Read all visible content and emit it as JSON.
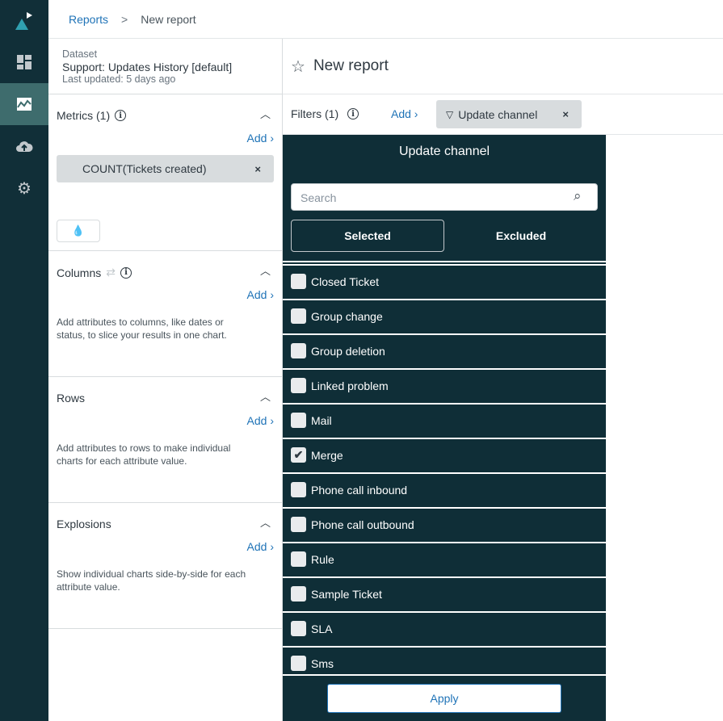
{
  "breadcrumb": {
    "parent": "Reports",
    "separator": ">",
    "current": "New report"
  },
  "dataset": {
    "label": "Dataset",
    "name": "Support: Updates History [default]",
    "updated": "Last updated: 5 days ago"
  },
  "metrics": {
    "title": "Metrics (1)",
    "add": "Add ›",
    "pill": "COUNT(Tickets created)",
    "remove": "×"
  },
  "columns": {
    "title": "Columns",
    "add": "Add ›",
    "help": "Add attributes to columns, like dates or status, to slice your results in one chart."
  },
  "rows": {
    "title": "Rows",
    "add": "Add ›",
    "help": "Add attributes to rows to make individual charts for each attribute value."
  },
  "explosions": {
    "title": "Explosions",
    "add": "Add ›",
    "help": "Show individual charts side-by-side for each attribute value."
  },
  "report": {
    "title": "New report"
  },
  "filters": {
    "title": "Filters (1)",
    "add": "Add ›",
    "chip": "Update channel",
    "remove": "×"
  },
  "popup": {
    "title": "Update channel",
    "search_placeholder": "Search",
    "tab_selected": "Selected",
    "tab_excluded": "Excluded",
    "apply": "Apply",
    "items": [
      {
        "label": "Closed Ticket",
        "checked": false
      },
      {
        "label": "Group change",
        "checked": false
      },
      {
        "label": "Group deletion",
        "checked": false
      },
      {
        "label": "Linked problem",
        "checked": false
      },
      {
        "label": "Mail",
        "checked": false
      },
      {
        "label": "Merge",
        "checked": true
      },
      {
        "label": "Phone call inbound",
        "checked": false
      },
      {
        "label": "Phone call outbound",
        "checked": false
      },
      {
        "label": "Rule",
        "checked": false
      },
      {
        "label": "Sample Ticket",
        "checked": false
      },
      {
        "label": "SLA",
        "checked": false
      },
      {
        "label": "Sms",
        "checked": false
      },
      {
        "label": "",
        "checked": false
      }
    ]
  },
  "colors": {
    "sidebar": "#112f38",
    "active": "#3e6c6d",
    "link": "#1f73b7",
    "popup": "#0f2e37"
  }
}
